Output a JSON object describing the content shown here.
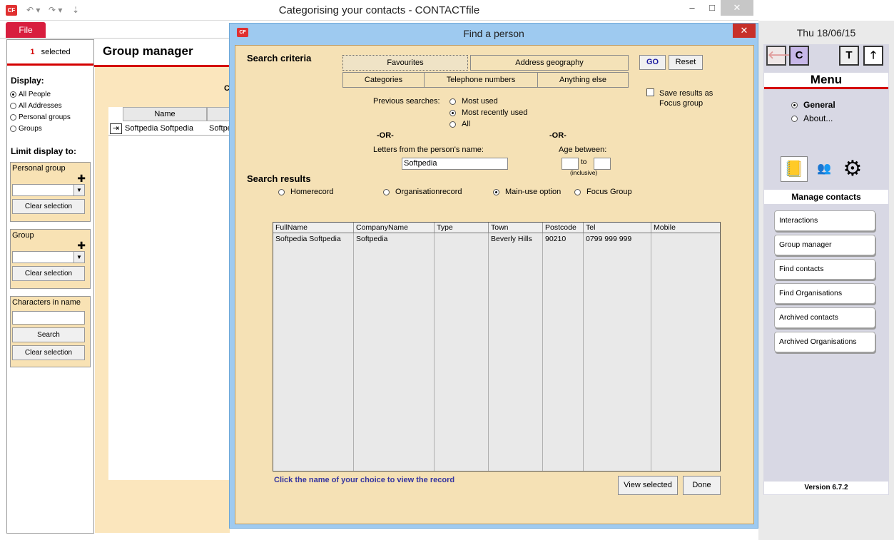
{
  "window": {
    "title": "Categorising your contacts  -  CONTACTfile",
    "logo_text": "CF",
    "minimize": "–",
    "maximize": "□",
    "close": "✕"
  },
  "ribbon": {
    "file_tab": "File"
  },
  "left_panel": {
    "selected_count": "1",
    "selected_label": "selected",
    "display_heading": "Display:",
    "display_options": [
      "All People",
      "All Addresses",
      "Personal groups",
      "Groups"
    ],
    "limit_heading": "Limit display to:",
    "personal_group": {
      "title": "Personal group",
      "clear": "Clear selection"
    },
    "group": {
      "title": "Group",
      "clear": "Clear selection"
    },
    "characters": {
      "title": "Characters in name",
      "search": "Search",
      "clear": "Clear selection"
    }
  },
  "group_manager": {
    "title": "Group manager",
    "partial_letter": "C",
    "column_name": "Name",
    "row_name": "Softpedia Softpedia",
    "row_partial": "Softpe"
  },
  "dialog": {
    "title": "Find a person",
    "logo_text": "CF",
    "close": "✕",
    "search_criteria": "Search criteria",
    "tabs": [
      "Favourites",
      "Address geography",
      "Categories",
      "Telephone numbers",
      "Anything else"
    ],
    "go": "GO",
    "reset": "Reset",
    "save_results": "Save results as Focus group",
    "previous_searches_label": "Previous searches:",
    "previous_options": [
      "Most used",
      "Most recently used",
      "All"
    ],
    "or_label": "-OR-",
    "letters_label": "Letters from the person's name:",
    "letters_value": "Softpedia",
    "age_label": "Age between:",
    "age_to": "to",
    "age_inclusive": "(inclusive)",
    "search_results": "Search results",
    "result_options": [
      "Homerecord",
      "Organisationrecord",
      "Main-use option",
      "Focus Group"
    ],
    "columns": [
      "FullName",
      "CompanyName",
      "Type",
      "Town",
      "Postcode",
      "Tel",
      "Mobile"
    ],
    "rows": [
      {
        "fullname": "Softpedia Softpedia",
        "company": "Softpedia",
        "type": "",
        "town": "Beverly Hills",
        "postcode": "90210",
        "tel": "0799 999 999",
        "mobile": ""
      }
    ],
    "hint": "Click the name of your choice to view the record",
    "view_selected": "View selected",
    "done": "Done"
  },
  "right_panel": {
    "date": "Thu 18/06/15",
    "c_button": "C",
    "t_button": "T",
    "menu_title": "Menu",
    "menu_options": [
      "General",
      "About..."
    ],
    "manage_title": "Manage contacts",
    "buttons": [
      "Interactions",
      "Group manager",
      "Find contacts",
      "Find Organisations",
      "Archived contacts",
      "Archived Organisations"
    ],
    "version": "Version 6.7.2"
  },
  "icons": [
    "back-arrow-icon",
    "up-arrow-icon",
    "contacts-book-icon",
    "people-checklist-icon",
    "gear-icon",
    "plus-icon",
    "dropdown-arrow-icon",
    "row-select-icon"
  ],
  "colors": {
    "accent_red": "#d40000",
    "file_tab": "#d81e3e",
    "dialog_frame": "#9ecaf0",
    "dialog_body": "#f5e1b5",
    "panel_beige": "#f8e2b4"
  }
}
